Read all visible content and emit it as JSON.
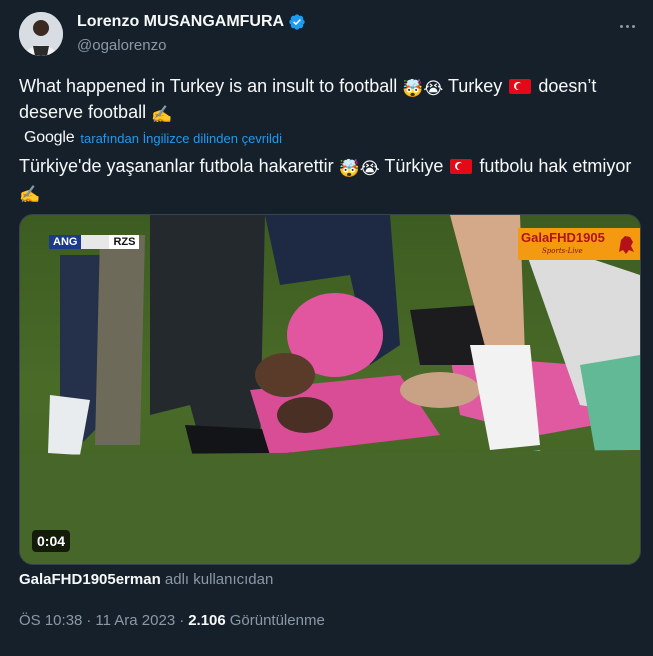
{
  "author": {
    "name": "Lorenzo MUSANGAMFURA",
    "handle": "@ogalorenzo",
    "verified_icon": "verified-badge-icon"
  },
  "tweet": {
    "text_part1": "What happened in Turkey is an insult to football ",
    "emoji1": "🤯",
    "emoji2": "😭",
    "text_part2": " Turkey ",
    "text_part3": " doesn’t deserve football ",
    "emoji3": "✍️"
  },
  "translation": {
    "provider": "Google",
    "label": "tarafından İngilizce dilinden çevrildi",
    "text_part1": "Türkiye'de yaşananlar futbola hakarettir ",
    "text_part2": " Türkiye ",
    "text_part3": " futbolu hak etmiyor ",
    "emoji3": "✍️"
  },
  "media": {
    "type": "video",
    "duration": "0:04",
    "scorebug_home": "ANG",
    "scorebug_away": "RZS",
    "watermark_title": "GalaFHD1905",
    "watermark_sub": "Sports-Live"
  },
  "source": {
    "username": "GalaFHD1905erman",
    "suffix": " adlı kullanıcıdan"
  },
  "meta": {
    "time": "ÖS 10:38",
    "separator": "·",
    "date": "11 Ara 2023",
    "views": "2.106",
    "views_label": "Görüntülenme"
  },
  "colors": {
    "background": "#15202b",
    "accent": "#1d9bf0",
    "secondary_text": "#8b98a5"
  }
}
